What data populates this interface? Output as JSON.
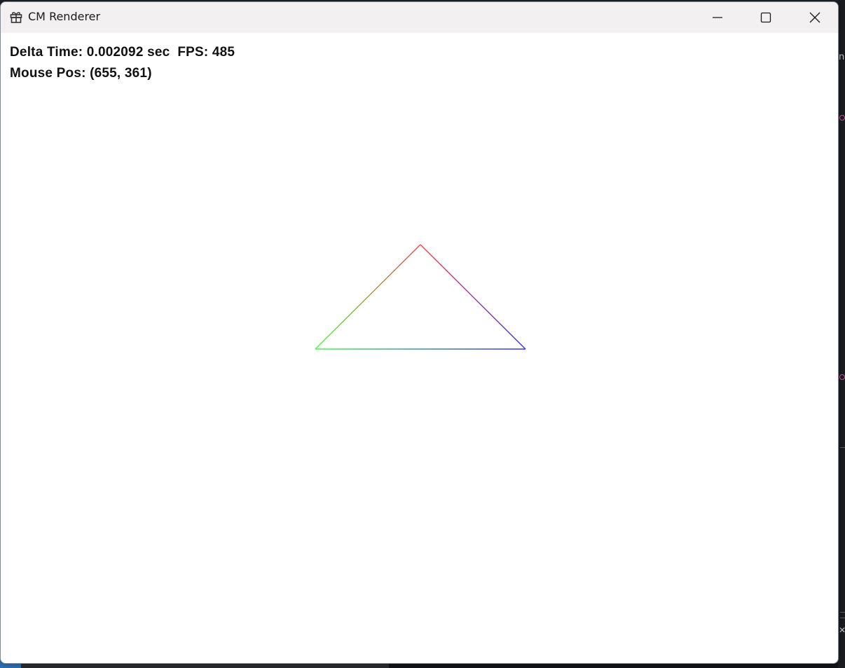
{
  "window": {
    "title": "CM Renderer",
    "app_icon": "gift-box-icon",
    "controls": {
      "minimize_icon": "minimize-icon",
      "maximize_icon": "maximize-icon",
      "close_icon": "close-icon"
    }
  },
  "hud": {
    "line1": "Delta Time: 0.002092 sec  FPS: 485",
    "line2": "Mouse Pos: (655, 361)"
  },
  "scene": {
    "triangle": {
      "vertex_colors": {
        "top": "#ff4040",
        "left": "#40ff40",
        "right": "#3030ff"
      }
    }
  },
  "background": {
    "right_edge_glyph": "n",
    "right_corner_glyph": "✕"
  }
}
